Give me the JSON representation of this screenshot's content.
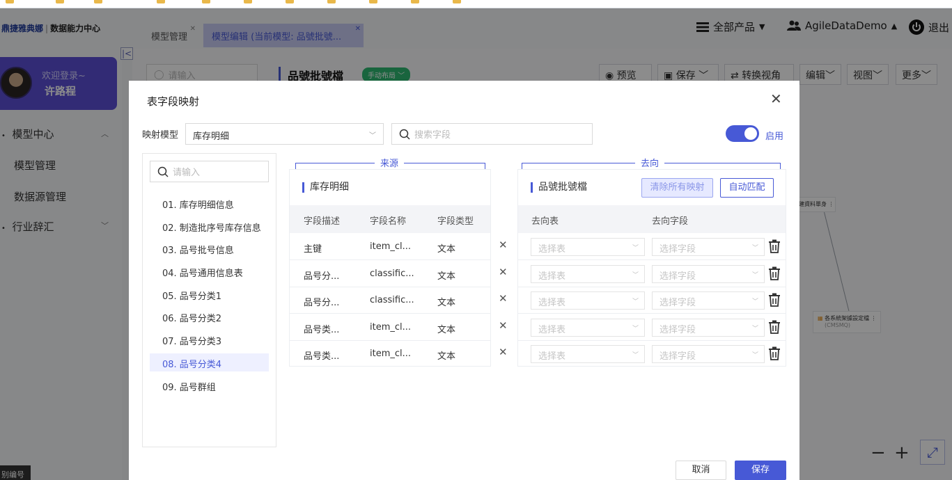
{
  "header": {
    "brand": "鼎捷雅典娜",
    "brand_sub": "数据能力中心",
    "tabs": [
      {
        "label": "模型管理"
      },
      {
        "label": "模型编辑 (当前模型: 品號批號..."
      }
    ],
    "products_label": "全部产品",
    "user_label": "AgileDataDemo",
    "logout_label": "退出"
  },
  "sidebar": {
    "welcome": "欢迎登录~",
    "username": "许路程",
    "items": [
      {
        "label": "模型中心"
      },
      {
        "label": "模型管理"
      },
      {
        "label": "数据源管理"
      },
      {
        "label": "行业辞汇"
      }
    ]
  },
  "canvas": {
    "search_placeholder": "请输入",
    "model_name": "品號批號檔",
    "layout_badge": "手动布局",
    "toolbar": {
      "preview": "预览",
      "save": "保存",
      "switch_view": "转换视角",
      "edit": "编辑",
      "view": "视图",
      "more": "更多"
    },
    "card1": "建資料單身",
    "card2": "各系統架據設定檔",
    "card2_sub": "(CMSMQ)",
    "bottom_tip": "别编号"
  },
  "modal": {
    "title": "表字段映射",
    "mapping_model_label": "映射模型",
    "mapping_model_value": "库存明细",
    "field_search_placeholder": "搜索字段",
    "enable_label": "启用",
    "enabled": true,
    "left_search_placeholder": "请输入",
    "tables": [
      {
        "label": "01. 库存明细信息"
      },
      {
        "label": "02. 制造批序号库存信息"
      },
      {
        "label": "03. 品号批号信息"
      },
      {
        "label": "04. 品号通用信息表"
      },
      {
        "label": "05. 品号分类1"
      },
      {
        "label": "06. 品号分类2"
      },
      {
        "label": "07. 品号分类3"
      },
      {
        "label": "08. 品号分类4"
      },
      {
        "label": "09. 品号群组"
      }
    ],
    "active_table_index": 7,
    "source": {
      "section_label": "来源",
      "panel_title": "库存明细",
      "columns": [
        "字段描述",
        "字段名称",
        "字段类型"
      ],
      "rows": [
        {
          "desc": "主键",
          "name": "item_cl...",
          "type": "文本"
        },
        {
          "desc": "品号分...",
          "name": "classific...",
          "type": "文本"
        },
        {
          "desc": "品号分...",
          "name": "classific...",
          "type": "文本"
        },
        {
          "desc": "品号类...",
          "name": "item_cl...",
          "type": "文本"
        },
        {
          "desc": "品号类...",
          "name": "item_cl...",
          "type": "文本"
        }
      ]
    },
    "target": {
      "section_label": "去向",
      "panel_title": "品號批號檔",
      "clear_label": "清除所有映射",
      "auto_label": "自动匹配",
      "columns": [
        "去向表",
        "去向字段"
      ],
      "table_placeholder": "选择表",
      "field_placeholder": "选择字段"
    },
    "cancel_label": "取消",
    "save_label": "保存"
  },
  "colors": {
    "accent": "#4759d6",
    "purple_card": "#5b4fd6",
    "overlay": "rgba(0,0,0,0.45)"
  }
}
